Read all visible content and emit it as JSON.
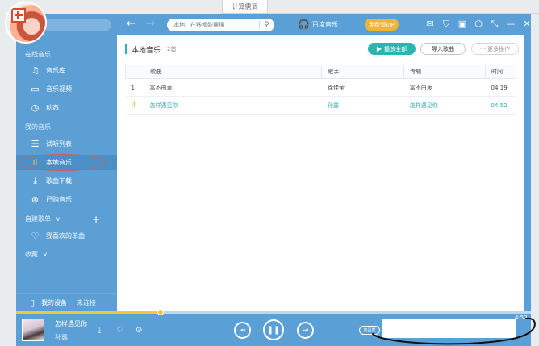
{
  "background": {
    "tab_text": "计算需调"
  },
  "colors": {
    "brand_blue": "#5a9fd5",
    "accent_teal": "#26b8b2",
    "accent_yellow": "#f3c43f",
    "vip_orange": "#f3b433",
    "highlight_red": "#d4585a"
  },
  "topbar": {
    "search_placeholder": "本地、在线都能搜搜",
    "brand": "百度音乐",
    "vip": "免费领VIP",
    "controls": [
      "mail-icon",
      "shirt-icon",
      "briefcase-icon",
      "settings-icon",
      "shrink-icon",
      "minimize-icon",
      "close-icon"
    ]
  },
  "sidebar": {
    "online_section": "在线音乐",
    "online_items": [
      {
        "label": "音乐库",
        "icon": "music-note-icon"
      },
      {
        "label": "音乐视频",
        "icon": "monitor-icon"
      },
      {
        "label": "动态",
        "icon": "clock-icon"
      }
    ],
    "my_section": "我的音乐",
    "my_items": [
      {
        "label": "试听列表",
        "icon": "playlist-icon"
      },
      {
        "label": "本地音乐",
        "icon": "bars-icon"
      },
      {
        "label": "歌曲下载",
        "icon": "download-icon"
      },
      {
        "label": "已购音乐",
        "icon": "purchased-icon"
      }
    ],
    "playlist_section": "自建歌单",
    "favorite": "我喜欢的单曲",
    "collect_section": "收藏",
    "device": "我的设备",
    "device_status": "未连接"
  },
  "content": {
    "title": "本地音乐",
    "count": "2首",
    "play_all": "播放全部",
    "import": "导入歌曲",
    "more": "··· 更多操作",
    "columns": [
      "歌曲",
      "歌手",
      "专辑",
      "时间"
    ],
    "rows": [
      {
        "num": "1",
        "song": "富不由衷",
        "artist": "徐佳莹",
        "album": "富不由衷",
        "time": "04:19"
      },
      {
        "num": "",
        "song": "怎样遇见你",
        "artist": "孙露",
        "album": "怎样遇见你",
        "time": "04:52"
      }
    ]
  },
  "player": {
    "title": "怎样遇见你",
    "artist": "孙露",
    "quality": "高品质",
    "total_time": "4:52",
    "progress_fraction": 0.28
  }
}
